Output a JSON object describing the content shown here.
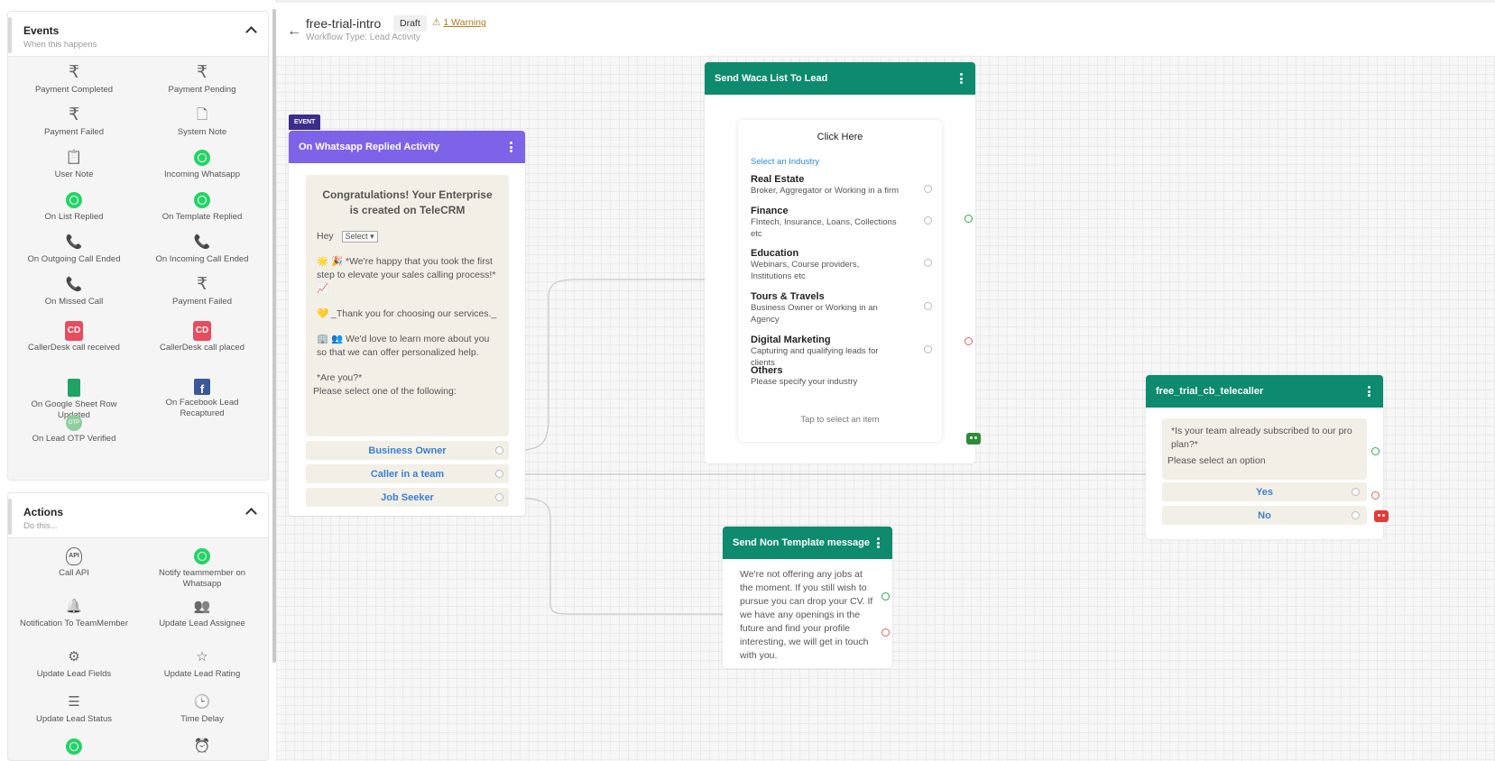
{
  "sidebar": {
    "events": {
      "title": "Events",
      "subtitle": "When this happens",
      "items": [
        {
          "label": "Payment Completed",
          "icon": "rupee-icon"
        },
        {
          "label": "Payment Pending",
          "icon": "rupee-icon"
        },
        {
          "label": "Payment Failed",
          "icon": "rupee-icon"
        },
        {
          "label": "System Note",
          "icon": "document-icon"
        },
        {
          "label": "User Note",
          "icon": "clipboard-icon"
        },
        {
          "label": "Incoming Whatsapp",
          "icon": "whatsapp-icon"
        },
        {
          "label": "On List Replied",
          "icon": "whatsapp-icon"
        },
        {
          "label": "On Template Replied",
          "icon": "whatsapp-icon"
        },
        {
          "label": "On Outgoing Call Ended",
          "icon": "phone-outgoing-icon"
        },
        {
          "label": "On Incoming Call Ended",
          "icon": "phone-incoming-icon"
        },
        {
          "label": "On Missed Call",
          "icon": "phone-missed-icon"
        },
        {
          "label": "Payment Failed",
          "icon": "rupee-icon"
        },
        {
          "label": "CallerDesk call received",
          "icon": "callerdesk-icon",
          "badge": "CD"
        },
        {
          "label": "CallerDesk call placed",
          "icon": "callerdesk-icon",
          "badge": "CD"
        },
        {
          "label": "On Google Sheet Row Updated",
          "icon": "google-sheet-icon"
        },
        {
          "label": "On Facebook Lead Recaptured",
          "icon": "facebook-icon",
          "badge": "f"
        },
        {
          "label": "On Lead OTP Verified",
          "icon": "otp-icon",
          "badge": "OTP"
        }
      ]
    },
    "actions": {
      "title": "Actions",
      "subtitle": "Do this...",
      "items": [
        {
          "label": "Call API",
          "icon": "api-icon",
          "badge": "API"
        },
        {
          "label": "Notify teammember on Whatsapp",
          "icon": "whatsapp-icon"
        },
        {
          "label": "Notification To TeamMember",
          "icon": "bell-icon"
        },
        {
          "label": "Update Lead Assignee",
          "icon": "users-icon"
        },
        {
          "label": "Update Lead Fields",
          "icon": "gear-icon"
        },
        {
          "label": "Update Lead Rating",
          "icon": "star-icon"
        },
        {
          "label": "Update Lead Status",
          "icon": "filter-icon"
        },
        {
          "label": "Time Delay",
          "icon": "clock-icon"
        },
        {
          "label": "",
          "icon": "whatsapp-icon"
        },
        {
          "label": "",
          "icon": "alarm-icon"
        }
      ]
    }
  },
  "header": {
    "workflow_name": "free-trial-intro",
    "status": "Draft",
    "warning_icon": "⚠",
    "warning": "1 Warning",
    "workflow_type": "Workflow Type: Lead Activity",
    "back_icon": "←"
  },
  "nodes": {
    "event": {
      "tag": "EVENT",
      "title": "On Whatsapp Replied Activity",
      "message_heading": "Congratulations! Your Enterprise is created on TeleCRM",
      "greeting": "Hey",
      "select_label": "Select",
      "line1": "🌟 🎉 *We're happy that you took the first step to elevate your sales calling process!* 📈",
      "line2": "💛 _Thank you for choosing our services._",
      "line3": "🏢 👥  We'd love to learn more about you so that we can offer personalized help.",
      "line4": "*Are you?*",
      "prompt": "Please select one of the following:",
      "options": [
        "Business Owner",
        "Caller in a team",
        "Job Seeker"
      ]
    },
    "waca_list": {
      "title": "Send Waca List To Lead",
      "card_title": "Click Here",
      "section": "Select an Industry",
      "rows": [
        {
          "title": "Real Estate",
          "desc": "Broker, Aggregator or Working in a firm"
        },
        {
          "title": "Finance",
          "desc": "FIntech, Insurance, Loans, Collections etc"
        },
        {
          "title": "Education",
          "desc": "Webinars, Course providers, Institutions etc"
        },
        {
          "title": "Tours & Travels",
          "desc": "Business Owner or Working in an Agency"
        },
        {
          "title": "Digital Marketing",
          "desc": "Capturing and qualifying leads for clients"
        },
        {
          "title": "Others",
          "desc": "Please specify your industry"
        }
      ],
      "footer": "Tap to select an item"
    },
    "non_template": {
      "title": "Send Non Template message",
      "body": "We're not offering any jobs at the moment. If you still wish to pursue you can drop your CV. If we have any openings in the future and find your profile interesting, we will get in touch with you."
    },
    "telecaller": {
      "title": "free_trial_cb_telecaller",
      "question": "*Is your team already subscribed to our pro plan?*",
      "prompt": "Please select an option",
      "options": [
        "Yes",
        "No"
      ]
    }
  },
  "colors": {
    "node_green": "#0e8a6e",
    "event_purple": "#7d63e8",
    "event_tag": "#3d2d8a",
    "option_text": "#3a7fd5",
    "bot_green": "#2e8b3a",
    "bot_red": "#e53935"
  }
}
